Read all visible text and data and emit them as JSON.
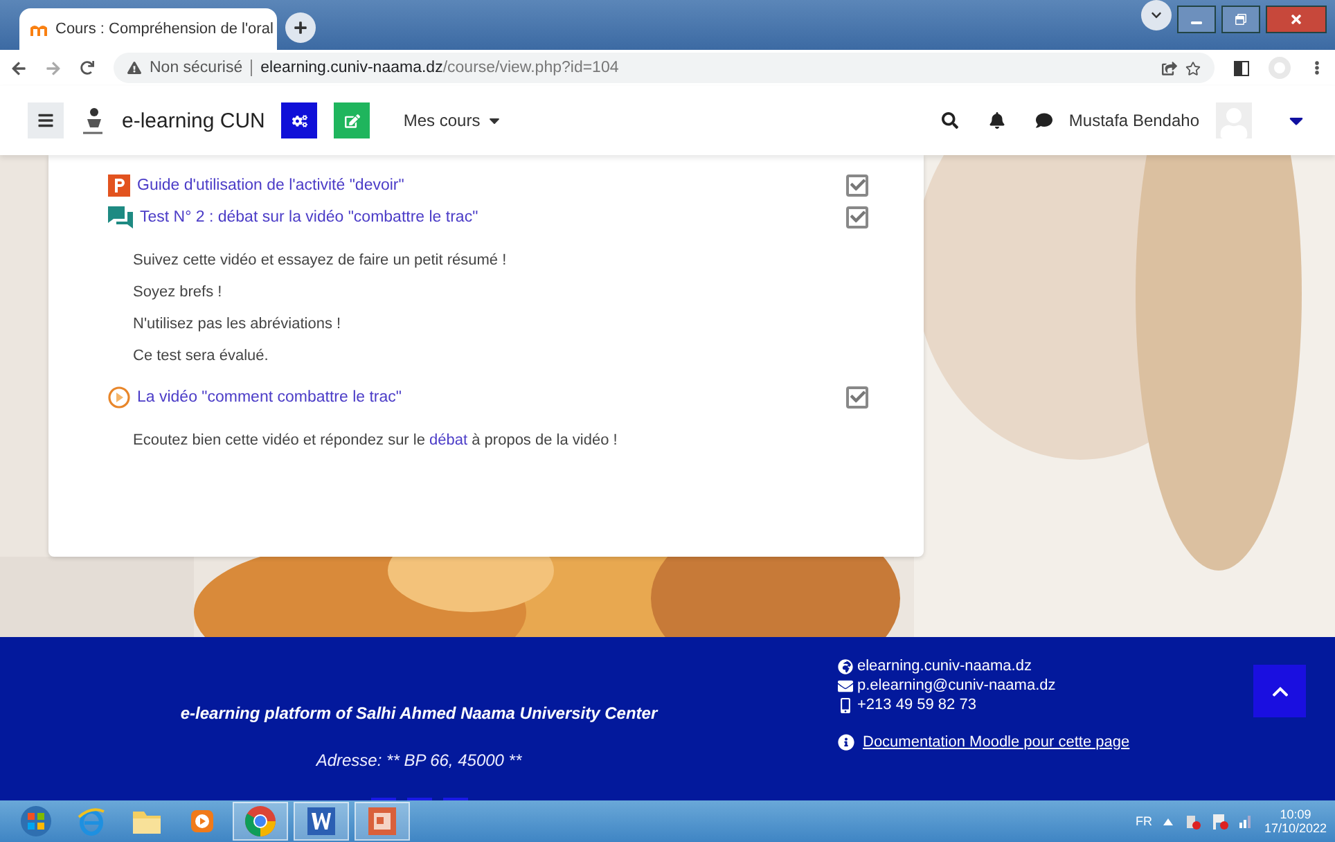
{
  "browser": {
    "tab_title": "Cours : Compréhension de l'oral",
    "security": "Non sécurisé",
    "url_host": "elearning.cuniv-naama.dz",
    "url_path": "/course/view.php?id=104"
  },
  "navbar": {
    "brand": "e-learning CUN",
    "menu": "Mes cours",
    "user": "Mustafa Bendaho"
  },
  "activities": [
    {
      "kind": "file",
      "title": "Guide d'utilisation de l'activité \"devoir\"",
      "checked": true
    },
    {
      "kind": "forum",
      "title": "Test N° 2 : débat sur la vidéo \"combattre le trac\"",
      "checked": true,
      "description": [
        {
          "text": "Suivez cette vidéo et essayez de faire un petit résumé !"
        },
        {
          "text": "Soyez brefs !"
        },
        {
          "text": "N'utilisez pas les abréviations !"
        },
        {
          "text": "Ce test sera évalué."
        }
      ]
    },
    {
      "kind": "video",
      "title": "La vidéo \"comment combattre le trac\"",
      "checked": true,
      "description": [
        {
          "text": "Ecoutez bien cette vidéo et répondez sur le",
          "link": "débat",
          "after": "à propos de la vidéo !"
        }
      ]
    }
  ],
  "footer": {
    "tagline": "e-learning platform of Salhi Ahmed Naama University Center",
    "address": "Adresse: **  BP 66, 45000 **",
    "contacts": [
      {
        "kind": "web",
        "text": "elearning.cuniv-naama.dz"
      },
      {
        "kind": "mail",
        "text": "p.elearning@cuniv-naama.dz"
      },
      {
        "kind": "phone",
        "text": "+213 49 59 82 73"
      }
    ],
    "doc_link": "Documentation Moodle pour cette page"
  },
  "taskbar": {
    "apps": [
      {
        "kind": "start",
        "selected": false
      },
      {
        "kind": "ie",
        "selected": false
      },
      {
        "kind": "folder",
        "selected": false
      },
      {
        "kind": "media",
        "selected": false
      },
      {
        "kind": "chrome",
        "selected": true
      },
      {
        "kind": "word",
        "selected": true
      },
      {
        "kind": "powerpoint",
        "selected": true
      }
    ],
    "lang": "FR",
    "time": "10:09",
    "date": "17/10/2022"
  }
}
